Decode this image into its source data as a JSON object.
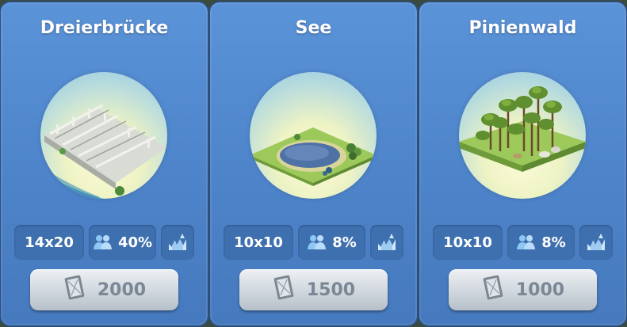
{
  "cards": [
    {
      "title": "Dreierbrücke",
      "size": "14x20",
      "population": "40%",
      "price": "2000",
      "image_icon": "three-bridge-illustration"
    },
    {
      "title": "See",
      "size": "10x10",
      "population": "8%",
      "price": "1500",
      "image_icon": "lake-illustration"
    },
    {
      "title": "Pinienwald",
      "size": "10x10",
      "population": "8%",
      "price": "1000",
      "image_icon": "pine-forest-illustration"
    }
  ],
  "icons": {
    "population": "people-icon",
    "environment": "environment-icon",
    "currency": "simoleon-banknote-icon"
  },
  "colors": {
    "card_background": "#4f86cc",
    "stat_background": "#3e6fae",
    "price_text": "#7b8794"
  }
}
